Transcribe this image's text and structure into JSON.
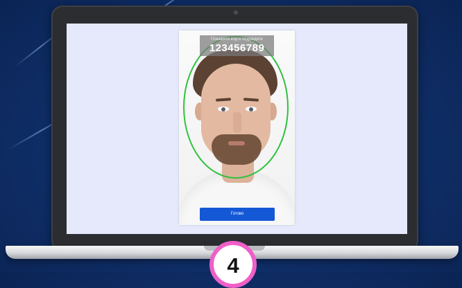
{
  "verification_ui": {
    "code_hint": "Покажите код и подождите",
    "code_value": "123456789",
    "done_button_label": "Готово"
  },
  "step_badge": {
    "label": "4"
  },
  "colors": {
    "background": "#10306b",
    "screen": "#e6e9fb",
    "frame_guide": "#2fc23e",
    "button": "#1558d6",
    "badge_ring": "#ee5fc8"
  },
  "icons": {
    "camera": "camera-dot",
    "face_guide": "oval-face-frame"
  }
}
